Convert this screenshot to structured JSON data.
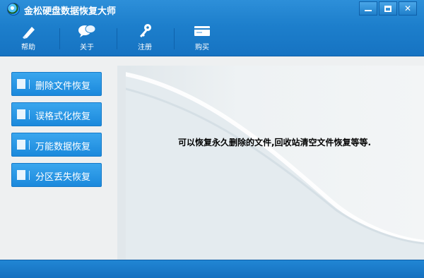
{
  "window": {
    "title": "金松硬盘数据恢复大师",
    "controls": {
      "minimize": "minimize",
      "maximize": "maximize",
      "close": "✕"
    }
  },
  "toolbar": {
    "items": [
      {
        "label": "帮助",
        "icon": "pen-icon"
      },
      {
        "label": "关于",
        "icon": "chat-bubbles-icon"
      },
      {
        "label": "注册",
        "icon": "key-icon"
      },
      {
        "label": "购买",
        "icon": "card-icon"
      }
    ]
  },
  "sidebar": {
    "buttons": [
      {
        "label": "删除文件恢复",
        "icon": "trash-icon"
      },
      {
        "label": "误格式化恢复",
        "icon": "drive-icon"
      },
      {
        "label": "万能数据恢复",
        "icon": "document-icon"
      },
      {
        "label": "分区丢失恢复",
        "icon": "partition-icon"
      }
    ]
  },
  "content": {
    "description": "可以恢复永久删除的文件,回收站清空文件恢复等等."
  },
  "colors": {
    "header_blue": "#1d7fcc",
    "button_blue": "#2a98e6",
    "background": "#eef0f1"
  }
}
